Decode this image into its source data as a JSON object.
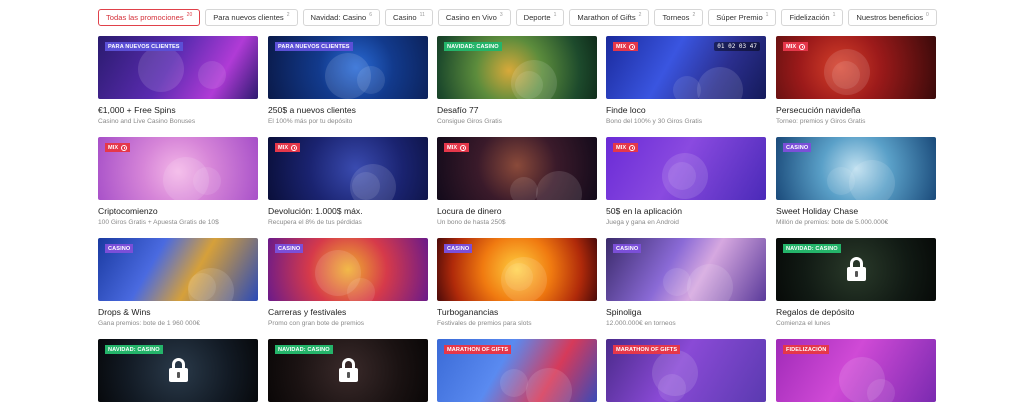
{
  "filters": [
    {
      "label": "Todas las promociones",
      "count": "20",
      "active": true
    },
    {
      "label": "Para nuevos clientes",
      "count": "2"
    },
    {
      "label": "Navidad: Casino",
      "count": "6"
    },
    {
      "label": "Casino",
      "count": "11"
    },
    {
      "label": "Casino en Vivo",
      "count": "3"
    },
    {
      "label": "Deporte",
      "count": "1"
    },
    {
      "label": "Marathon of Gifts",
      "count": "2"
    },
    {
      "label": "Torneos",
      "count": "2"
    },
    {
      "label": "Súper Premio",
      "count": "1"
    },
    {
      "label": "Fidelización",
      "count": "1"
    },
    {
      "label": "Nuestros beneficios",
      "count": "0"
    }
  ],
  "colors": {
    "accent": "#e0414a",
    "tag_new_clients": "#5b4fd6",
    "tag_christmas": "#24b46a",
    "tag_mix": "#e5374a",
    "tag_casino": "#7b4fd8",
    "tag_marathon": "#e5374a",
    "tag_loyalty": "#e5374a"
  },
  "promotions": [
    {
      "tag": "PARA NUEVOS CLIENTES",
      "tag_type": "new",
      "title": "€1,000 + Free Spins",
      "subtitle": "Casino and Live Casino Bonuses",
      "bg": "linear-gradient(120deg,#2a1b6e 0%,#5a2bb0 45%,#b03bd6 75%,#2d1a70 100%)",
      "icon": "slot-machine-art",
      "locked": false
    },
    {
      "tag": "PARA NUEVOS CLIENTES",
      "tag_type": "new",
      "title": "250$ a nuevos clientes",
      "subtitle": "El 100% más por tu depósito",
      "bg": "radial-gradient(circle at 55% 50%,#2a6bd6 0%,#123a8c 40%,#0a1a4a 100%)",
      "icon": "soccer-ball-art",
      "locked": false
    },
    {
      "tag": "NAVIDAD: CASINO",
      "tag_type": "christmas",
      "title": "Desafío 77",
      "subtitle": "Consigue Giros Gratis",
      "bg": "radial-gradient(circle at 45% 55%,#d8a93a 0%,#5c8c3c 35%,#1d4a2c 75%,#0f2b1a 100%)",
      "icon": "gift-box-art",
      "locked": false
    },
    {
      "tag": "MIX",
      "tag_type": "mix",
      "title": "Finde loco",
      "subtitle": "Bono del 100% y 30 Giros Gratis",
      "bg": "linear-gradient(120deg,#1a2a9c 0%,#3a55e0 40%,#2b2f8f 70%,#141a5a 100%)",
      "icon": "slot-777-art",
      "locked": false,
      "extra": "01 02 03 47"
    },
    {
      "tag": "MIX",
      "tag_type": "mix",
      "title": "Persecución navideña",
      "subtitle": "Torneo: premios y Giros Gratis",
      "bg": "radial-gradient(circle at 40% 50%,#d6402a 0%,#9c1a1a 40%,#3a0a0a 100%)",
      "icon": "santa-art",
      "locked": false
    },
    {
      "tag": "MIX",
      "tag_type": "mix",
      "title": "Criptocomienzo",
      "subtitle": "100 Giros Gratis + Apuesta Gratis de 10$",
      "bg": "radial-gradient(circle at 50% 55%,#f4b7e8 0%,#d685d8 40%,#a64fc8 100%)",
      "icon": "crypto-coins-art",
      "locked": false
    },
    {
      "tag": "MIX",
      "tag_type": "mix",
      "title": "Devolución: 1.000$ máx.",
      "subtitle": "Recupera el 8% de tus pérdidas",
      "bg": "radial-gradient(circle at 55% 50%,#3a4bb0 0%,#1a2370 50%,#0a0f3a 100%)",
      "icon": "roulette-art",
      "locked": false
    },
    {
      "tag": "MIX",
      "tag_type": "mix",
      "title": "Locura de dinero",
      "subtitle": "Un bono de hasta 250$",
      "bg": "radial-gradient(circle at 50% 45%,#8a4a3a 0%,#3a1a2a 45%,#120a1a 100%)",
      "icon": "woman-cards-art",
      "locked": false
    },
    {
      "tag": "MIX",
      "tag_type": "mix",
      "title": "50$ en la aplicación",
      "subtitle": "Juega y gana en Android",
      "bg": "linear-gradient(120deg,#6a2bd6 0%,#8a4ae0 45%,#4a2ab8 100%)",
      "icon": "smartphone-art",
      "locked": false
    },
    {
      "tag": "CASINO",
      "tag_type": "casino",
      "title": "Sweet Holiday Chase",
      "subtitle": "Millón de premios: bote de 5.000.000€",
      "bg": "radial-gradient(circle at 50% 50%,#c0e0f0 0%,#5aa0c8 40%,#1a4a7a 100%)",
      "icon": "santa-elf-art",
      "locked": false
    },
    {
      "tag": "CASINO",
      "tag_type": "casino",
      "title": "Drops & Wins",
      "subtitle": "Gana premios: bote de 1 960 000€",
      "bg": "linear-gradient(120deg,#1a3aa0 0%,#4a6ae0 35%,#d6a03a 60%,#2a4ab8 100%)",
      "icon": "mermaid-art",
      "locked": false
    },
    {
      "tag": "CASINO",
      "tag_type": "casino",
      "title": "Carreras y festivales",
      "subtitle": "Promo con gran bote de premios",
      "bg": "radial-gradient(circle at 50% 50%,#f0b030 0%,#d63a4a 45%,#6a1a8a 100%)",
      "icon": "jester-art",
      "locked": false
    },
    {
      "tag": "CASINO",
      "tag_type": "casino",
      "title": "Turboganancias",
      "subtitle": "Festivales de premios para slots",
      "bg": "radial-gradient(circle at 50% 50%,#ffd040 0%,#f07a10 40%,#b02a0a 75%,#4a0a0a 100%)",
      "icon": "fire-art",
      "locked": false
    },
    {
      "tag": "CASINO",
      "tag_type": "casino",
      "title": "Spinoliga",
      "subtitle": "12.000.000€ en torneos",
      "bg": "linear-gradient(120deg,#3a2a6a 0%,#8a6ad6 40%,#d6a8e0 60%,#5a3a9a 100%)",
      "icon": "zeus-athena-art",
      "locked": false
    },
    {
      "tag": "NAVIDAD: CASINO",
      "tag_type": "christmas",
      "title": "Regalos de depósito",
      "subtitle": "Comienza el lunes",
      "bg": "radial-gradient(circle at 50% 50%,#2a3a2a 0%,#111a14 60%,#070a08 100%)",
      "icon": "lock-icon",
      "locked": true
    },
    {
      "tag": "NAVIDAD: CASINO",
      "tag_type": "christmas",
      "title": "",
      "subtitle": "",
      "bg": "radial-gradient(circle at 50% 50%,#2a3a4a 0%,#121a24 60%,#07090c 100%)",
      "icon": "lock-icon",
      "locked": true
    },
    {
      "tag": "NAVIDAD: CASINO",
      "tag_type": "christmas",
      "title": "",
      "subtitle": "",
      "bg": "radial-gradient(circle at 50% 50%,#3a2a2a 0%,#1a1212 60%,#0a0707 100%)",
      "icon": "lock-icon",
      "locked": true
    },
    {
      "tag": "MARATHON OF GIFTS",
      "tag_type": "marathon",
      "title": "",
      "subtitle": "",
      "bg": "linear-gradient(120deg,#3a6ad6 0%,#5a8af0 40%,#d63a5a 70%,#3a4ab8 100%)",
      "icon": "gift-tower-art",
      "locked": false
    },
    {
      "tag": "MARATHON OF GIFTS",
      "tag_type": "marathon",
      "title": "",
      "subtitle": "",
      "bg": "linear-gradient(120deg,#4a2a8a 0%,#8a4ad6 45%,#5a3ab0 100%)",
      "icon": "mystery-box-art",
      "locked": false
    },
    {
      "tag": "FIDELIZACIÓN",
      "tag_type": "loyalty",
      "title": "",
      "subtitle": "",
      "bg": "linear-gradient(120deg,#a02ab8 0%,#d04ad6 45%,#7a2ab0 100%)",
      "icon": "piggy-bank-art",
      "locked": false
    }
  ]
}
